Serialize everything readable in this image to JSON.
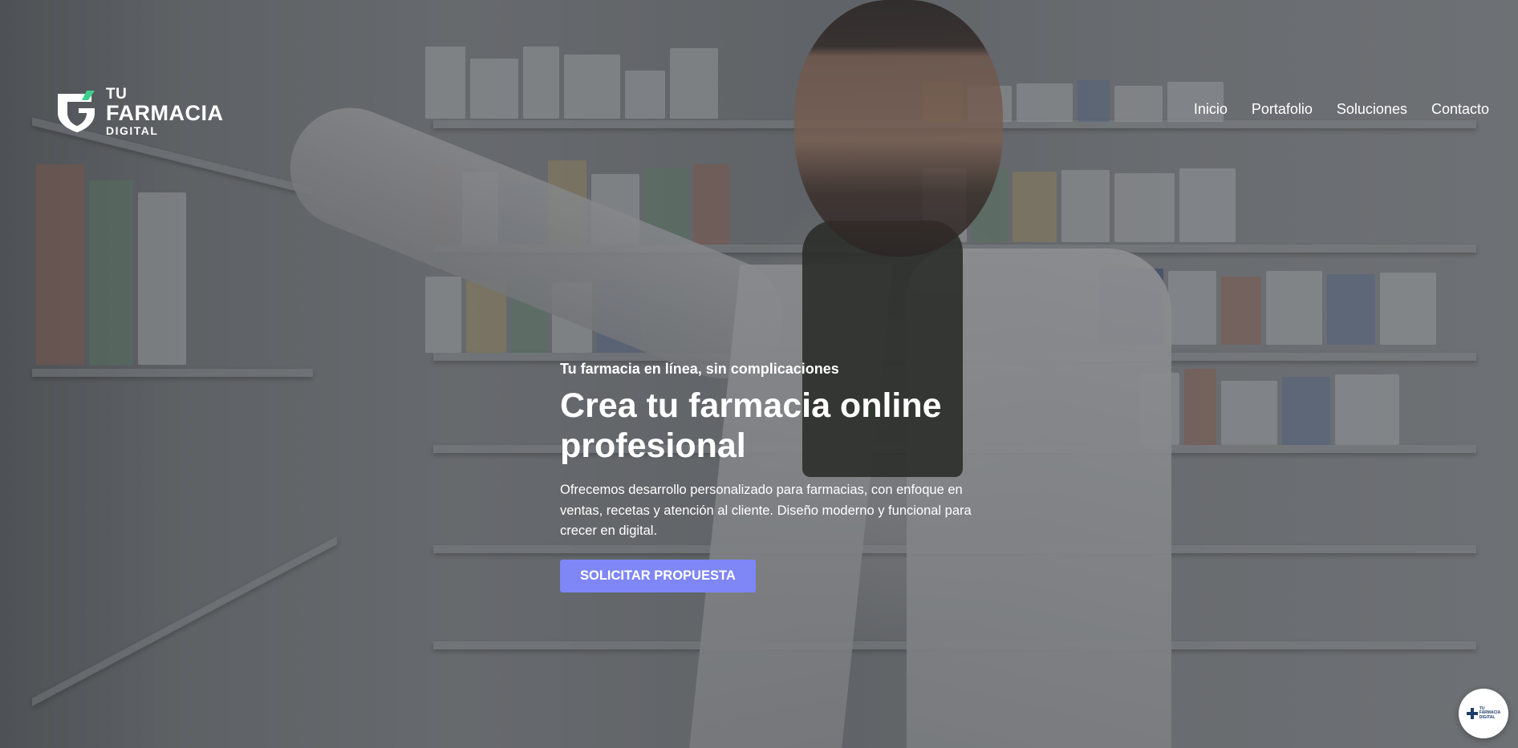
{
  "brand": {
    "line1": "TU",
    "line2": "FARMACIA",
    "line3": "DIGITAL",
    "accent": "#3ecf8e"
  },
  "nav": {
    "items": [
      {
        "label": "Inicio"
      },
      {
        "label": "Portafolio"
      },
      {
        "label": "Soluciones"
      },
      {
        "label": "Contacto"
      }
    ]
  },
  "hero": {
    "eyebrow": "Tu farmacia en línea, sin complicaciones",
    "title": "Crea tu farmacia online profesional",
    "description": "Ofrecemos desarrollo personalizado para farmacias, con enfoque en ventas, recetas y atención al cliente. Diseño moderno y funcional para crecer en digital.",
    "cta_label": "SOLICITAR PROPUESTA",
    "cta_color": "#7f86f5",
    "background_image": "pharmacist-smiling-in-pharmacy"
  },
  "floating_button": {
    "icon": "brand-logo-icon",
    "line1": "TU",
    "line2": "FARMACIA",
    "line3": "DIGITAL",
    "color": "#1f3d6b"
  }
}
